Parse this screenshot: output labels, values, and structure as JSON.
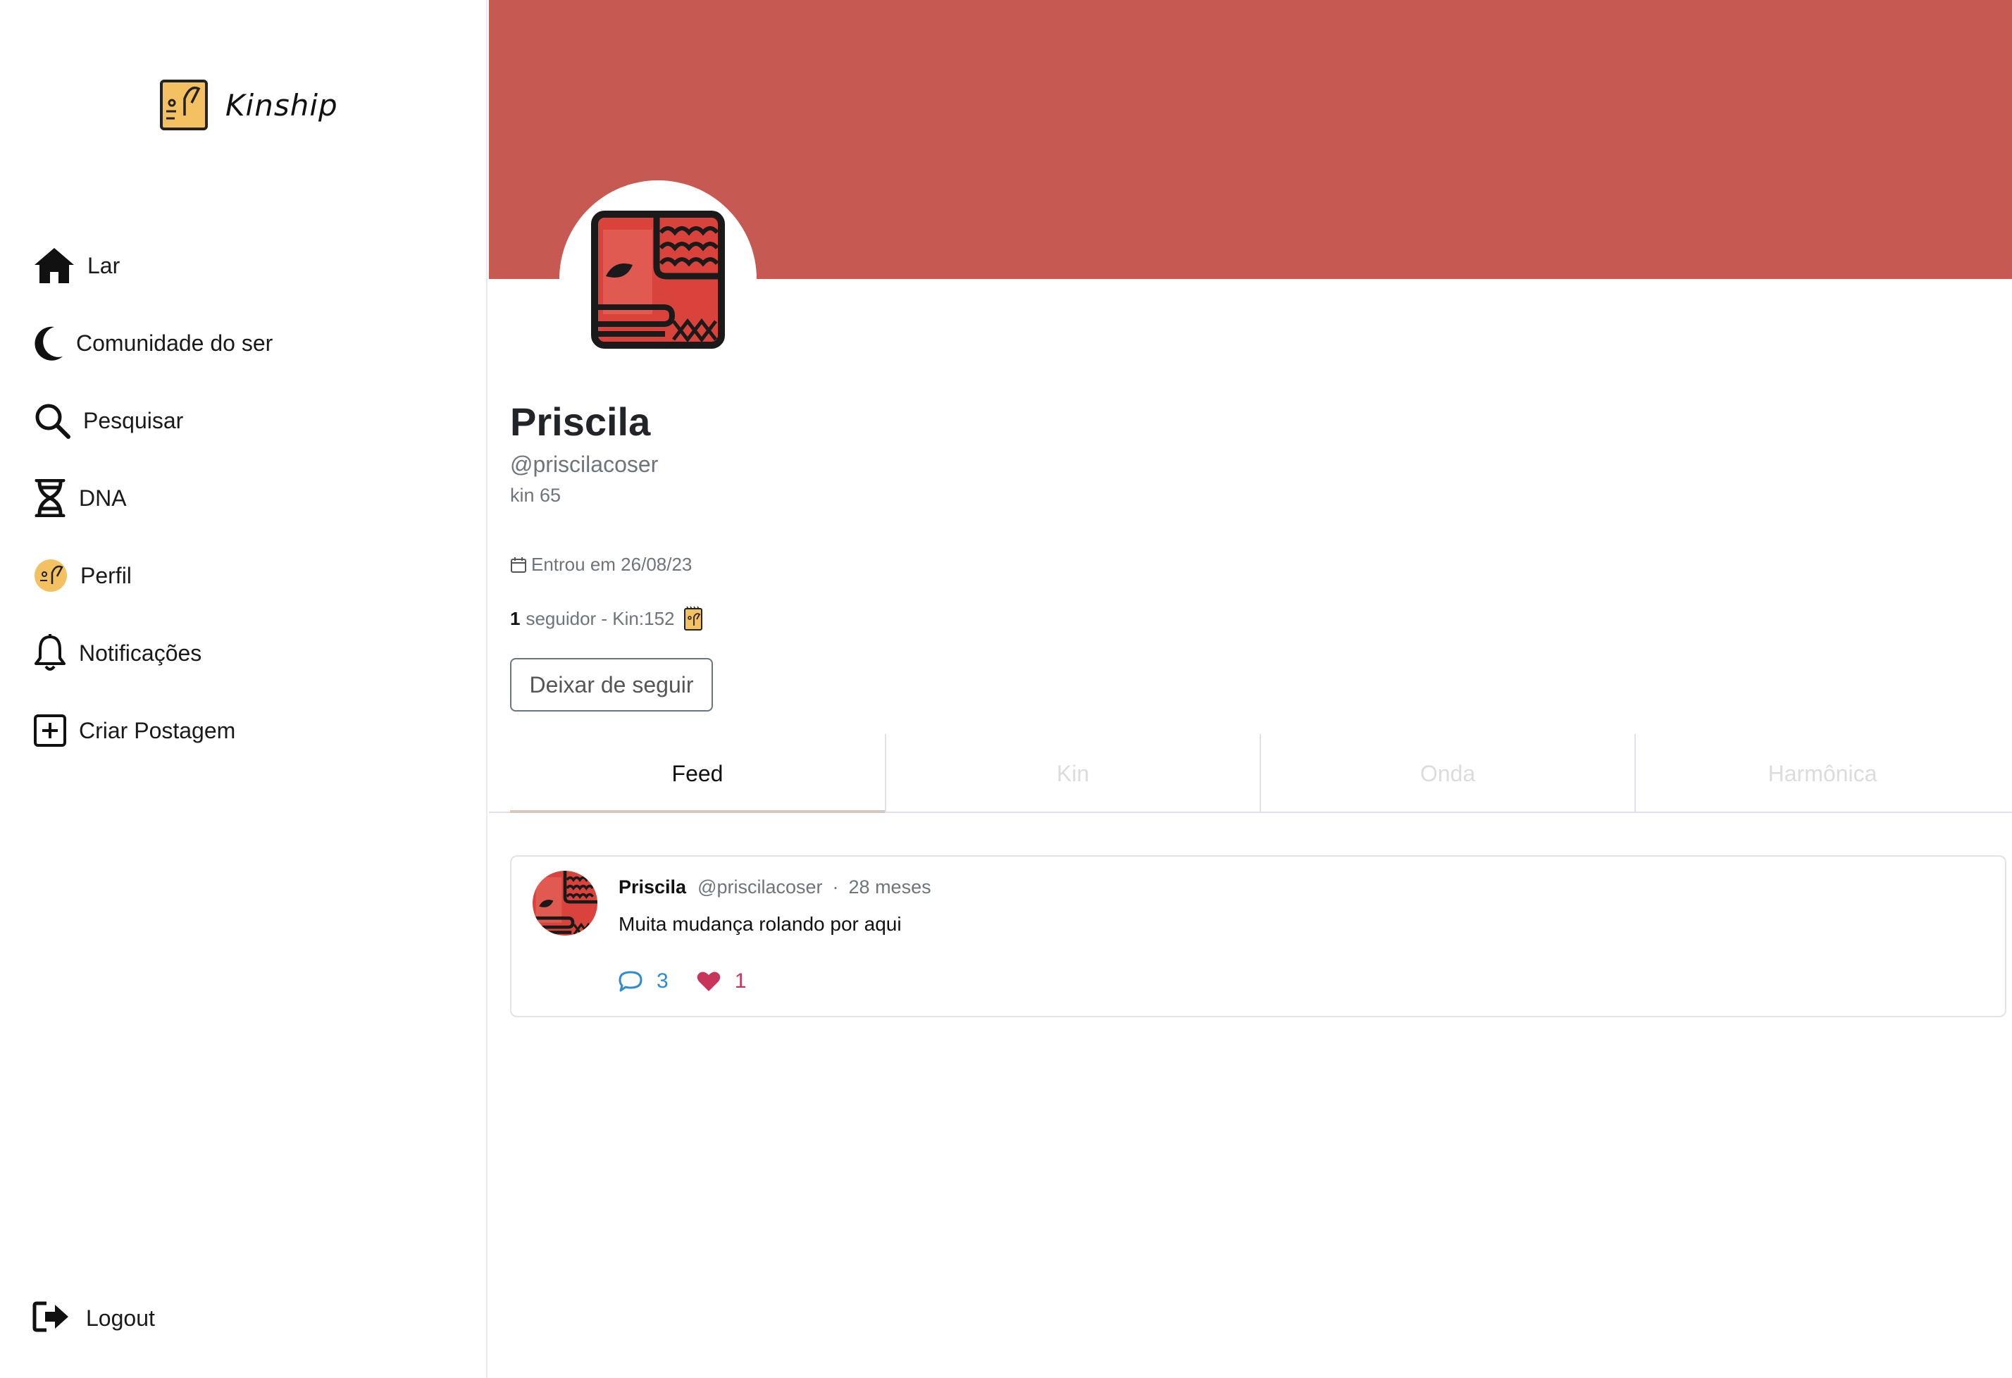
{
  "app": {
    "brand": "Kinship"
  },
  "sidebar": {
    "items": [
      {
        "label": "Lar",
        "icon": "home-icon"
      },
      {
        "label": "Comunidade do ser",
        "icon": "moon-icon"
      },
      {
        "label": "Pesquisar",
        "icon": "search-icon"
      },
      {
        "label": "DNA",
        "icon": "dna-icon"
      },
      {
        "label": "Perfil",
        "icon": "avatar-icon"
      },
      {
        "label": "Notificações",
        "icon": "bell-icon"
      },
      {
        "label": "Criar Postagem",
        "icon": "plus-square-icon"
      }
    ],
    "logout": "Logout"
  },
  "profile": {
    "banner_color": "#c65a52",
    "name": "Priscila",
    "handle": "@priscilacoser",
    "kin": "kin 65",
    "joined": "Entrou em 26/08/23",
    "followers_count": "1",
    "followers_text": "seguidor - Kin:152",
    "unfollow_label": "Deixar de seguir"
  },
  "tabs": [
    {
      "label": "Feed",
      "active": true
    },
    {
      "label": "Kin",
      "active": false
    },
    {
      "label": "Onda",
      "active": false
    },
    {
      "label": "Harmônica",
      "active": false
    }
  ],
  "post": {
    "author": "Priscila",
    "handle": "@priscilacoser",
    "separator": "·",
    "time": "28 meses",
    "body": "Muita mudança rolando por aqui",
    "comments": "3",
    "likes": "1"
  },
  "colors": {
    "accent_blue": "#2f8bd1",
    "like_pink": "#c7355b",
    "glyph_red": "#d9433b",
    "glyph_yellow": "#f3c062"
  }
}
